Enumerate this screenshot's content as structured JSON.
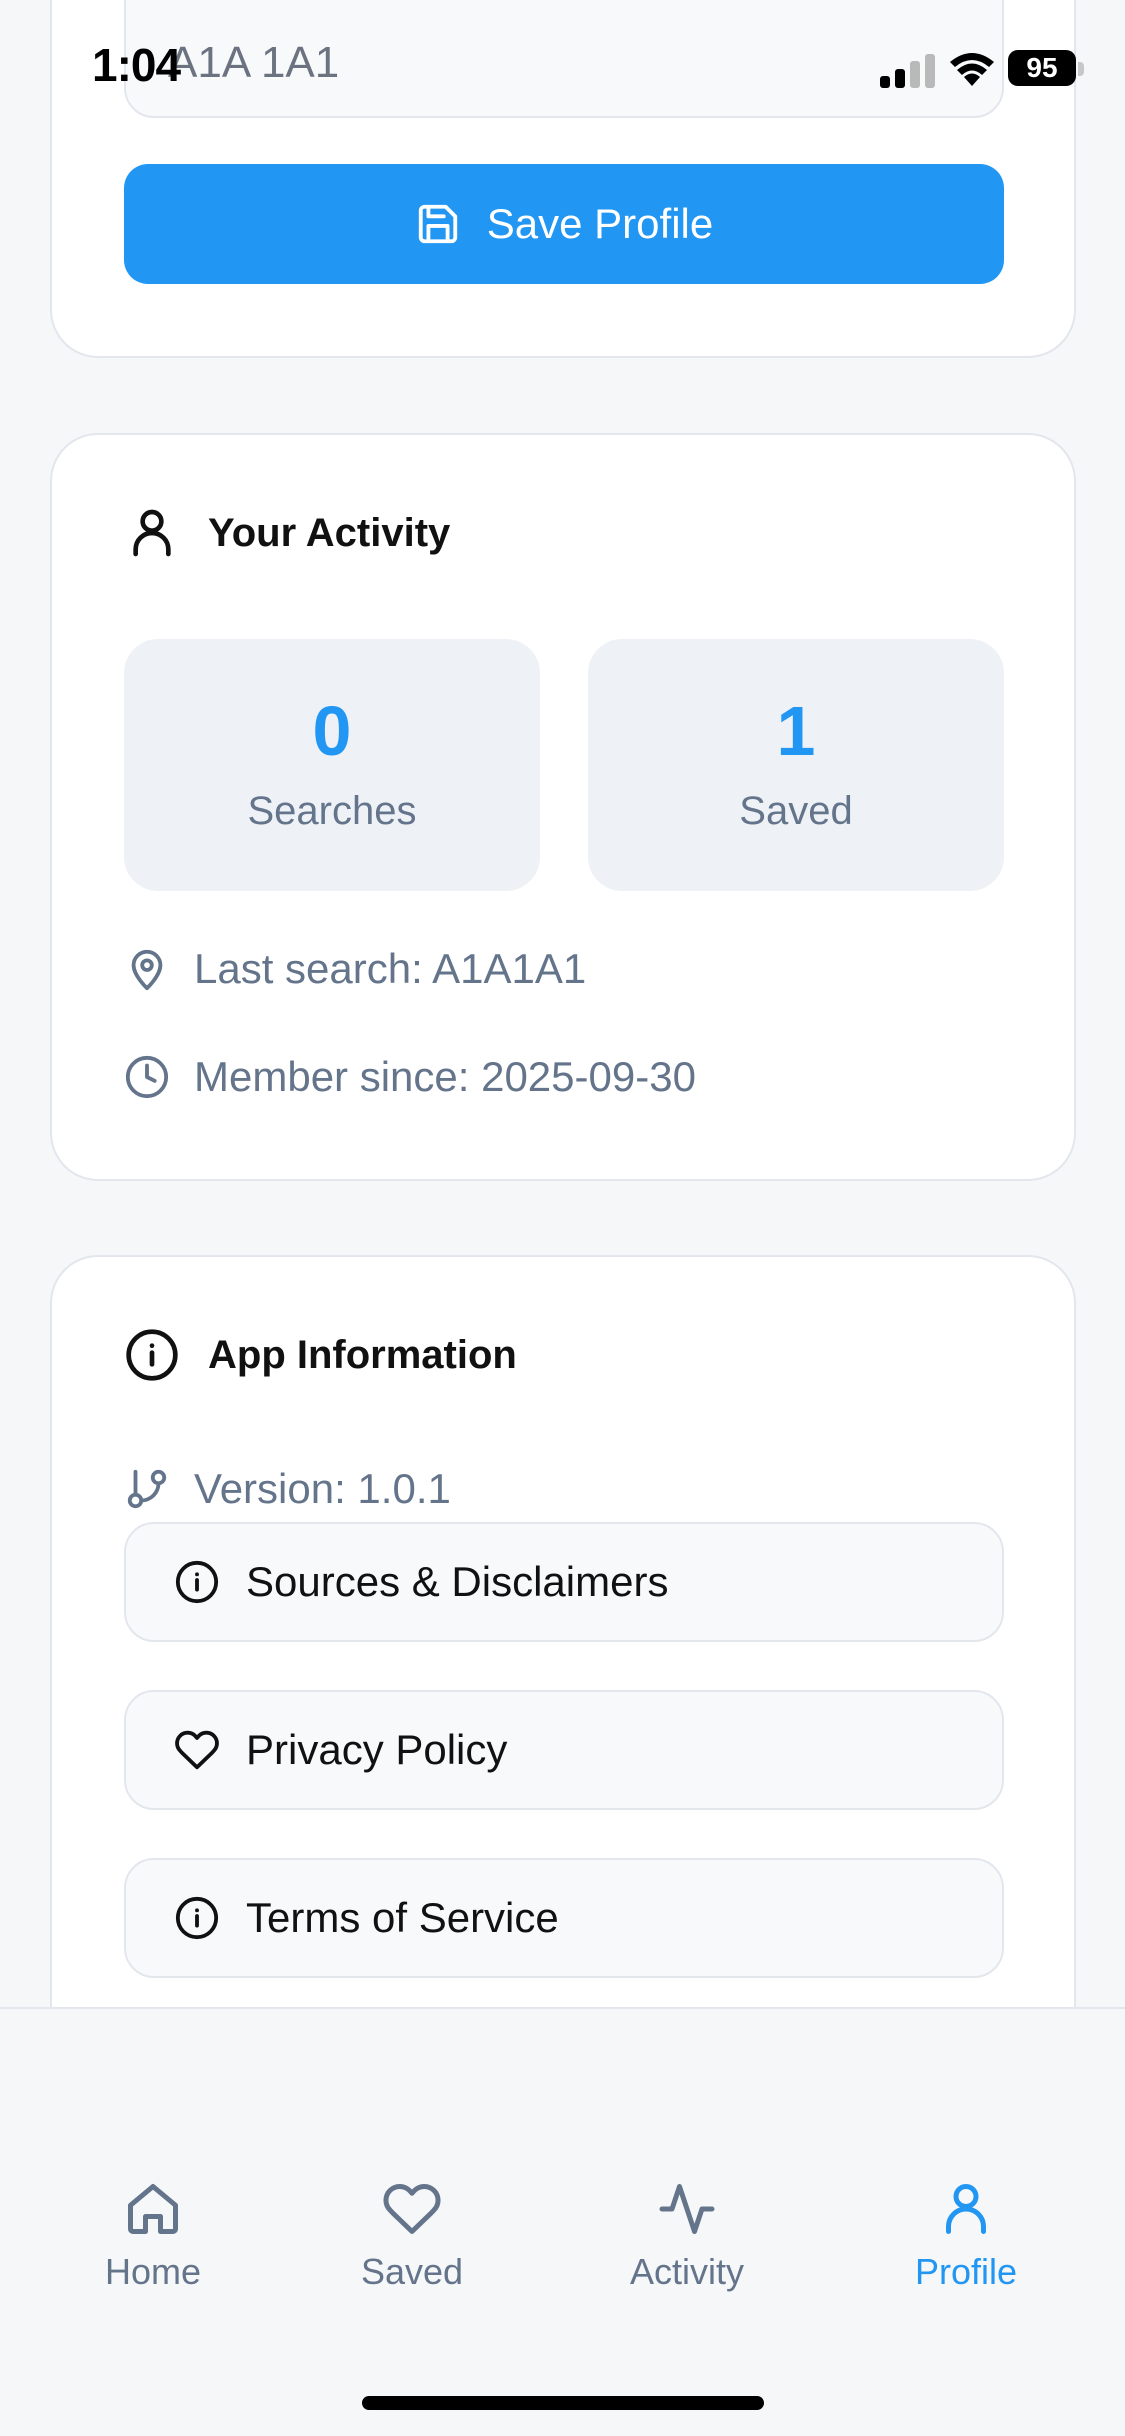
{
  "status_bar": {
    "time": "1:04",
    "battery": "95"
  },
  "profile_form": {
    "postal_code_value": "A1A 1A1",
    "save_label": "Save Profile"
  },
  "activity": {
    "title": "Your Activity",
    "stats": [
      {
        "value": "0",
        "label": "Searches"
      },
      {
        "value": "1",
        "label": "Saved"
      }
    ],
    "last_search": "Last search: A1A1A1",
    "member_since": "Member since: 2025-09-30"
  },
  "app_info": {
    "title": "App Information",
    "version": "Version: 1.0.1",
    "links": [
      {
        "label": "Sources & Disclaimers",
        "icon": "info-icon"
      },
      {
        "label": "Privacy Policy",
        "icon": "heart-icon"
      },
      {
        "label": "Terms of Service",
        "icon": "info-icon"
      }
    ]
  },
  "tab_bar": {
    "items": [
      {
        "label": "Home",
        "icon": "home-icon",
        "active": false
      },
      {
        "label": "Saved",
        "icon": "heart-icon",
        "active": false
      },
      {
        "label": "Activity",
        "icon": "activity-icon",
        "active": false
      },
      {
        "label": "Profile",
        "icon": "user-icon",
        "active": true
      }
    ]
  },
  "colors": {
    "accent": "#2196f3",
    "muted_text": "#64748b",
    "stat_bg": "#eef2f7",
    "border": "#e3e6ec"
  }
}
